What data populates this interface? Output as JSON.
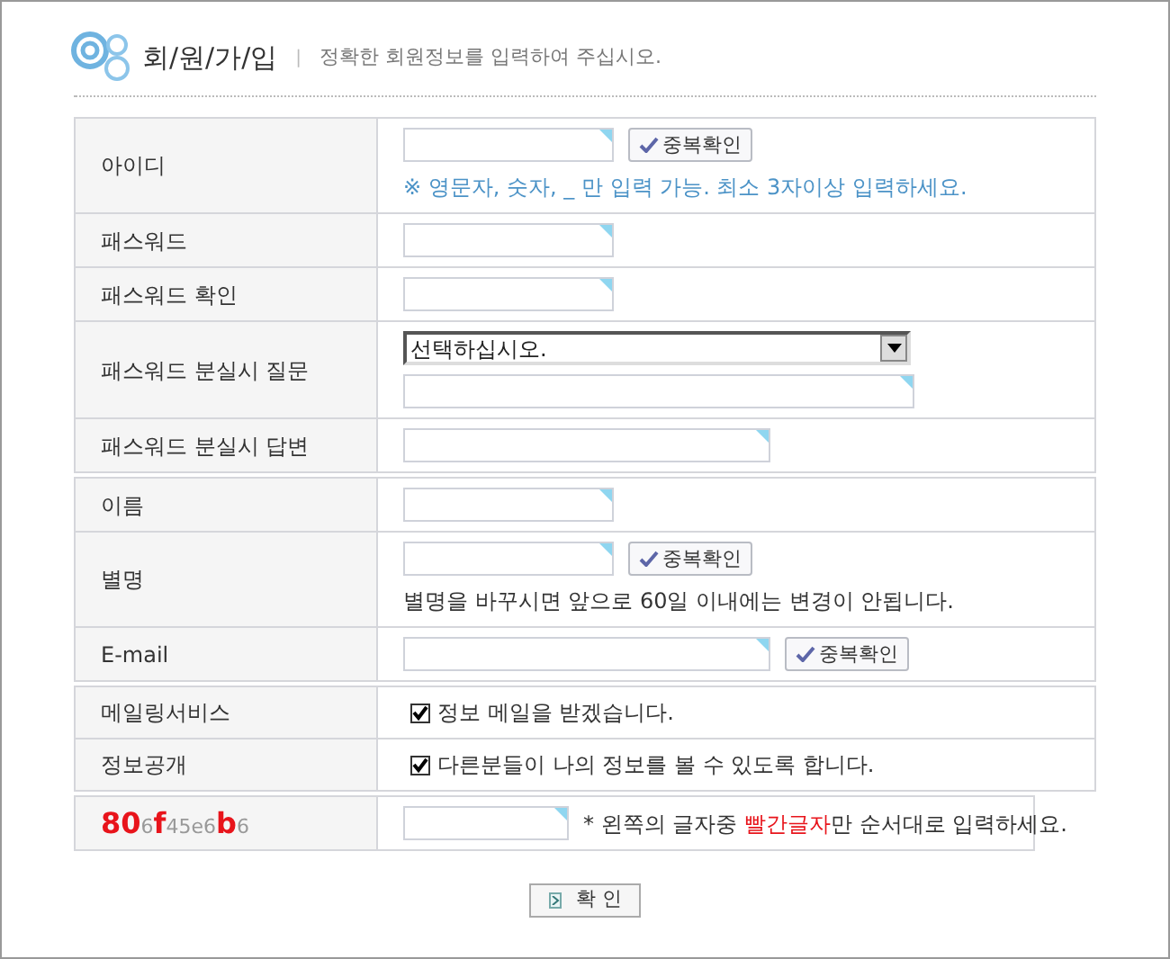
{
  "header": {
    "title": "회/원/가/입",
    "separator": "|",
    "subtitle": "정확한 회원정보를 입력하여 주십시오."
  },
  "sections": [
    {
      "rows": [
        {
          "label": "아이디",
          "lines": [
            [
              {
                "kind": "input"
              },
              {
                "kind": "check_button",
                "label": "중복확인"
              }
            ],
            [
              {
                "kind": "hint",
                "text": "※ 영문자, 숫자, _ 만 입력 가능. 최소 3자이상 입력하세요."
              }
            ]
          ]
        },
        {
          "label": "패스워드",
          "lines": [
            [
              {
                "kind": "input"
              }
            ]
          ]
        },
        {
          "label": "패스워드 확인",
          "lines": [
            [
              {
                "kind": "input"
              }
            ]
          ]
        },
        {
          "label": "패스워드 분실시 질문",
          "lines": [
            [
              {
                "kind": "select",
                "value": "선택하십시오."
              }
            ],
            [
              {
                "kind": "long_input"
              }
            ]
          ]
        },
        {
          "label": "패스워드 분실시 답변",
          "lines": [
            [
              {
                "kind": "wide_input"
              }
            ]
          ]
        }
      ]
    },
    {
      "rows": [
        {
          "label": "이름",
          "lines": [
            [
              {
                "kind": "input"
              }
            ]
          ]
        },
        {
          "label": "별명",
          "lines": [
            [
              {
                "kind": "input"
              },
              {
                "kind": "check_button",
                "label": "중복확인"
              }
            ],
            [
              {
                "kind": "note",
                "text": "별명을 바꾸시면 앞으로 60일 이내에는 변경이 안됩니다."
              }
            ]
          ]
        },
        {
          "label": "E-mail",
          "lines": [
            [
              {
                "kind": "wide_input"
              },
              {
                "kind": "check_button",
                "label": "중복확인"
              }
            ]
          ]
        }
      ]
    },
    {
      "rows": [
        {
          "label": "메일링서비스",
          "lines": [
            [
              {
                "kind": "checkbox",
                "checked": true,
                "label": "정보 메일을 받겠습니다."
              }
            ]
          ]
        },
        {
          "label": "정보공개",
          "lines": [
            [
              {
                "kind": "checkbox",
                "checked": true,
                "label": "다른분들이 나의 정보를 볼 수 있도록 합니다."
              }
            ]
          ]
        }
      ]
    }
  ],
  "captcha": {
    "code": [
      {
        "text": "80",
        "highlight": true
      },
      {
        "text": "6",
        "highlight": false
      },
      {
        "text": "f",
        "highlight": true
      },
      {
        "text": "45e6",
        "highlight": false
      },
      {
        "text": "b",
        "highlight": true
      },
      {
        "text": "6",
        "highlight": false
      }
    ],
    "instruction": [
      {
        "text": "* 왼쪽의 글자중 ",
        "highlight": false
      },
      {
        "text": "빨간글자",
        "highlight": true
      },
      {
        "text": "만 순서대로 입력하세요.",
        "highlight": false
      }
    ]
  },
  "submit": {
    "label": "확 인"
  }
}
